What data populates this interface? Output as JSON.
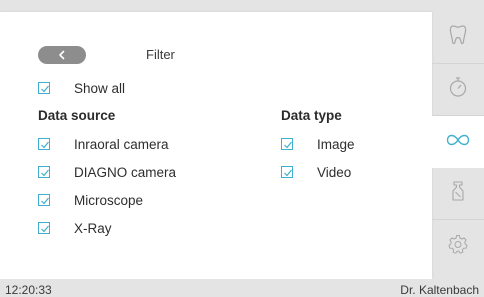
{
  "header": {
    "title": "Filter",
    "back_icon": "chevron-left-icon"
  },
  "filter": {
    "show_all": {
      "label": "Show all",
      "checked": true
    },
    "data_source": {
      "heading": "Data source",
      "items": [
        {
          "label": "Inraoral camera",
          "checked": true
        },
        {
          "label": "DIAGNO camera",
          "checked": true
        },
        {
          "label": "Microscope",
          "checked": true
        },
        {
          "label": "X-Ray",
          "checked": true
        }
      ]
    },
    "data_type": {
      "heading": "Data type",
      "items": [
        {
          "label": "Image",
          "checked": true
        },
        {
          "label": "Video",
          "checked": true
        }
      ]
    }
  },
  "sidebar": {
    "items": [
      {
        "icon": "tooth-icon",
        "active": false
      },
      {
        "icon": "timer-icon",
        "active": false
      },
      {
        "icon": "infinity-icon",
        "active": true
      },
      {
        "icon": "cleaning-bottle-icon",
        "active": false
      },
      {
        "icon": "gear-icon",
        "active": false
      }
    ]
  },
  "status": {
    "time": "12:20:33",
    "user": "Dr. Kaltenbach"
  },
  "colors": {
    "accent": "#3fb0cf",
    "back_button": "#8d8d8d",
    "background": "#e4e4e4",
    "panel": "#ffffff",
    "icon_gray": "#a8a8a8"
  }
}
